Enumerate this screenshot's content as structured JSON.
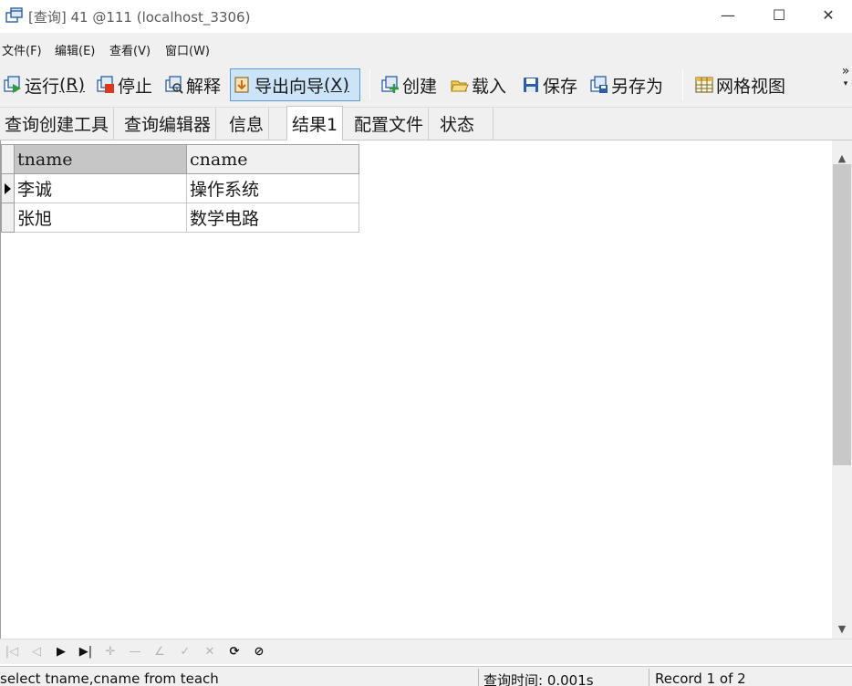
{
  "window": {
    "title": "[查询] 41 @111 (localhost_3306)",
    "controls": {
      "minimize": "—",
      "maximize": "☐",
      "close": "✕"
    }
  },
  "menu": {
    "file": "文件(F)",
    "edit": "编辑(E)",
    "view": "查看(V)",
    "window": "窗口(W)"
  },
  "toolbar": {
    "run": {
      "text": "运行",
      "key": "(R)"
    },
    "stop": "停止",
    "explain": "解释",
    "export_wizard": {
      "text": "导出向导",
      "key": "(X)"
    },
    "create": "创建",
    "load": "载入",
    "save": "保存",
    "save_as": "另存为",
    "grid_view": "网格视图",
    "overflow": "»"
  },
  "tabs": [
    "查询创建工具",
    "查询编辑器",
    "信息",
    "结果1",
    "配置文件",
    "状态"
  ],
  "active_tab_index": 3,
  "result_grid": {
    "columns": [
      "tname",
      "cname"
    ],
    "rows": [
      [
        "李诚",
        "操作系统"
      ],
      [
        "张旭",
        "数学电路"
      ]
    ]
  },
  "navigator": {
    "first": "|◁",
    "prev": "◁",
    "next": "▶",
    "last": "▶|",
    "insert": "✛",
    "delete": "—",
    "edit": "∠",
    "apply": "✓",
    "cancel": "✕",
    "refresh": "⟳",
    "stop": "⊘"
  },
  "status": {
    "sql": "select tname,cname from teach",
    "query_time": "查询时间: 0.001s",
    "record": "Record 1 of 2"
  },
  "colors": {
    "chrome": "#f0f0f0",
    "active_button": "#cce4f7",
    "active_border": "#5b9bd5",
    "header_sorted": "#c6c6c6"
  }
}
